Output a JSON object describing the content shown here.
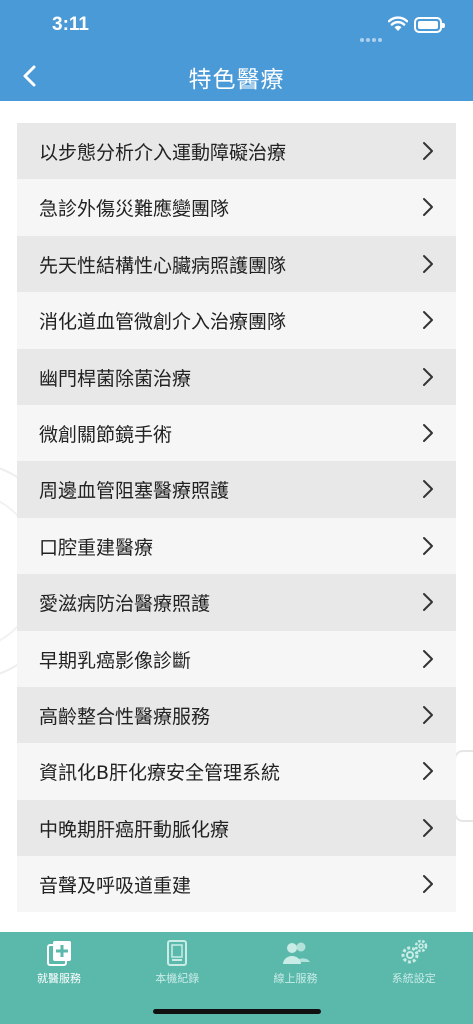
{
  "status": {
    "time": "3:11"
  },
  "nav": {
    "title": "特色醫療"
  },
  "items": [
    "以步態分析介入運動障礙治療",
    "急診外傷災難應變團隊",
    "先天性結構性心臟病照護團隊",
    "消化道血管微創介入治療團隊",
    "幽門桿菌除菌治療",
    "微創關節鏡手術",
    "周邊血管阻塞醫療照護",
    "口腔重建醫療",
    "愛滋病防治醫療照護",
    "早期乳癌影像診斷",
    "高齡整合性醫療服務",
    "資訊化B肝化療安全管理系統",
    "中晚期肝癌肝動脈化療",
    "音聲及呼吸道重建"
  ],
  "tabs": [
    {
      "label": "就醫服務",
      "icon": "medical-service-icon",
      "active": true
    },
    {
      "label": "本機紀錄",
      "icon": "records-icon",
      "active": false
    },
    {
      "label": "線上服務",
      "icon": "online-service-icon",
      "active": false
    },
    {
      "label": "系統設定",
      "icon": "settings-icon",
      "active": false
    }
  ],
  "colors": {
    "header": "#4a9ad8",
    "tabbar": "#5bb9ac",
    "row_dark": "#e8e8e8",
    "row_light": "#f6f6f6"
  }
}
